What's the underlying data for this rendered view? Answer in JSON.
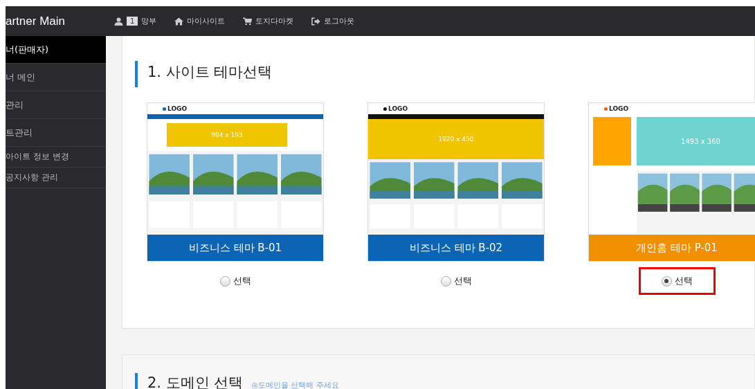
{
  "sidebar": {
    "title": "artner Main",
    "items": [
      {
        "label": "너(판매자)",
        "selected": true
      },
      {
        "label": "너 메인",
        "selected": false
      },
      {
        "label": "관리",
        "selected": false
      },
      {
        "label": "트관리",
        "selected": false
      },
      {
        "label": "아이트 정보 변경",
        "selected": false
      },
      {
        "label": "공지사항 관리",
        "selected": false
      }
    ]
  },
  "top_nav": [
    {
      "kind": "user",
      "badge": "1",
      "label": "망부"
    },
    {
      "kind": "home",
      "label": "마이사이트"
    },
    {
      "kind": "cart",
      "label": "토지다마켓"
    },
    {
      "kind": "logout",
      "label": "로그아웃"
    }
  ],
  "section_1": {
    "title": "1. 사이트 테마선택",
    "themes": [
      {
        "kind": "business",
        "name": "비즈니스 테마 B-01",
        "color": "#0c64b4",
        "logo": "LOGO",
        "banner_size": "994 x 193",
        "option": "선택",
        "selected": false
      },
      {
        "kind": "wide",
        "name": "비즈니스 테마 B-02",
        "color": "#0c64b4",
        "logo": "LOGO",
        "banner_size": "1920 x 450",
        "option": "선택",
        "selected": false
      },
      {
        "kind": "personal",
        "name": "개인홈 테마 P-01",
        "color": "#f09000",
        "logo": "LOGO",
        "banner_size": "1493 x 360",
        "option": "선택",
        "selected": true
      }
    ]
  },
  "section_2": {
    "title": "2. 도메인 선택",
    "hint": "◎도메인을 선택해 주세요"
  }
}
